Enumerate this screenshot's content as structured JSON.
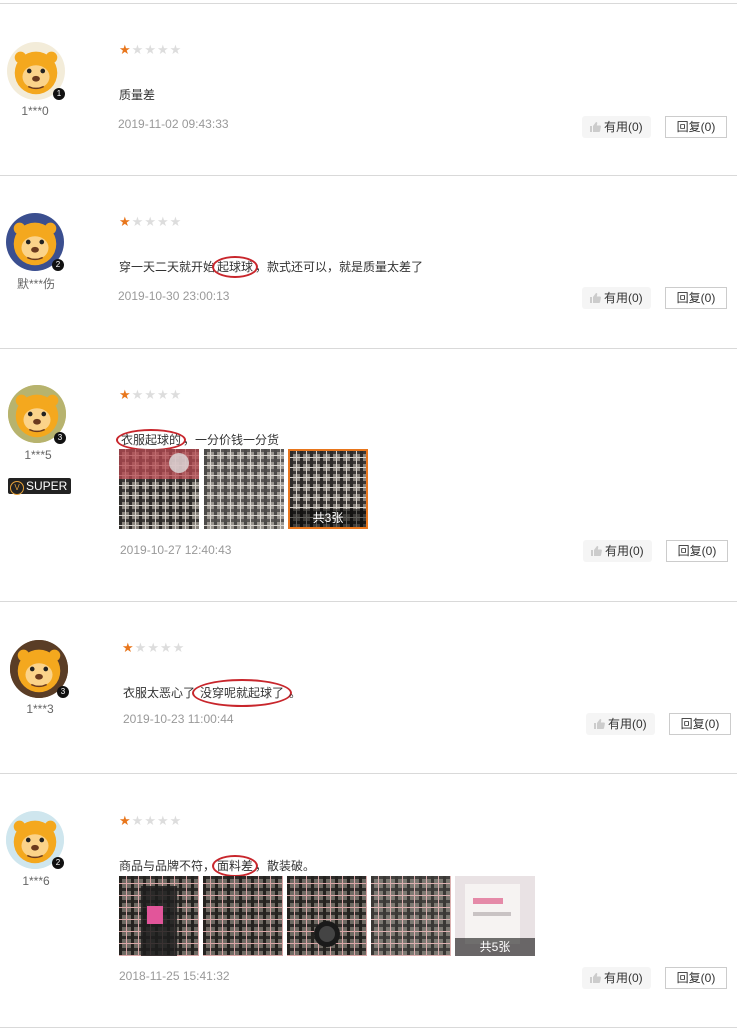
{
  "reviews": [
    {
      "username": "1***0",
      "rating": 1,
      "content_before": "质量差",
      "content_highlight": "",
      "content_after": "",
      "date": "2019-11-02 09:43:33",
      "useful_label": "有用(0)",
      "reply_label": "回复(0)"
    },
    {
      "username": "默***伤",
      "rating": 1,
      "content_before": "穿一天二天就开始",
      "content_highlight": "起球球",
      "content_after": "，款式还可以，就是质量太差了",
      "date": "2019-10-30 23:00:13",
      "useful_label": "有用(0)",
      "reply_label": "回复(0)"
    },
    {
      "username": "1***5",
      "badge": "SUPER",
      "rating": 1,
      "content_before": "",
      "content_highlight": "衣服起球的",
      "content_after": "，一分价钱一分货",
      "image_count_label": "共3张",
      "date": "2019-10-27 12:40:43",
      "useful_label": "有用(0)",
      "reply_label": "回复(0)"
    },
    {
      "username": "1***3",
      "rating": 1,
      "content_before": "衣服太恶心了",
      "content_highlight": "没穿呢就起球了",
      "content_after": "。",
      "date": "2019-10-23 11:00:44",
      "useful_label": "有用(0)",
      "reply_label": "回复(0)"
    },
    {
      "username": "1***6",
      "rating": 1,
      "content_before": "商品与品牌不符，",
      "content_highlight": "面料差",
      "content_after": "，散装破。",
      "image_count_label": "共5张",
      "date": "2018-11-25 15:41:32",
      "useful_label": "有用(0)",
      "reply_label": "回复(0)"
    }
  ],
  "colors": {
    "star_on": "#e8761c",
    "star_off": "#dddddd",
    "highlight_circle": "#c8262c",
    "date_text": "#999999"
  },
  "icons": [
    "star-icon",
    "thumbs-up-icon",
    "level-badge-icon",
    "super-member-icon"
  ]
}
